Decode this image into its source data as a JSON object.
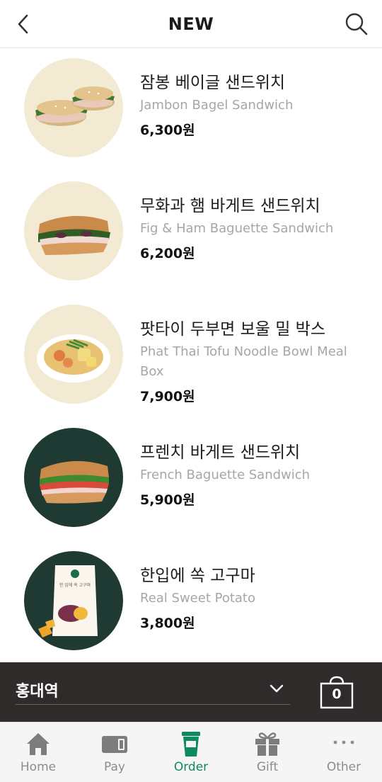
{
  "header": {
    "title": "NEW",
    "back_icon": "chevron-left-icon",
    "search_icon": "search-icon"
  },
  "products": [
    {
      "name_ko": "잠봉 베이글 샌드위치",
      "name_en": "Jambon Bagel Sandwich",
      "price": "6,300원",
      "image": "bagel-sandwich-image",
      "bg_color": "#f3ead3"
    },
    {
      "name_ko": "무화과 햄 바게트 샌드위치",
      "name_en": "Fig & Ham Baguette Sandwich",
      "price": "6,200원",
      "image": "baguette-sandwich-image",
      "bg_color": "#f3ead3"
    },
    {
      "name_ko": "팟타이 두부면 보울 밀 박스",
      "name_en": "Phat Thai Tofu Noodle Bowl Meal Box",
      "price": "7,900원",
      "image": "noodle-bowl-image",
      "bg_color": "#f3ead3"
    },
    {
      "name_ko": "프렌치 바게트 샌드위치",
      "name_en": "French Baguette Sandwich",
      "price": "5,900원",
      "image": "french-baguette-image",
      "bg_color": "#1f3a33"
    },
    {
      "name_ko": "한입에 쏙 고구마",
      "name_en": "Real Sweet Potato",
      "price": "3,800원",
      "image": "sweet-potato-pouch-image",
      "bg_color": "#1f3a33",
      "pouch_text": "한 입에 쏙 고구마"
    }
  ],
  "store_bar": {
    "store_name": "홍대역",
    "cart_count": "0",
    "bg_color": "#2f2b2a"
  },
  "bottom_nav": {
    "active_color": "#0e8a5f",
    "items": [
      {
        "label": "Home",
        "icon": "home-icon",
        "active": false
      },
      {
        "label": "Pay",
        "icon": "card-icon",
        "active": false
      },
      {
        "label": "Order",
        "icon": "cup-icon",
        "active": true
      },
      {
        "label": "Gift",
        "icon": "gift-icon",
        "active": false
      },
      {
        "label": "Other",
        "icon": "more-dots-icon",
        "active": false
      }
    ]
  }
}
